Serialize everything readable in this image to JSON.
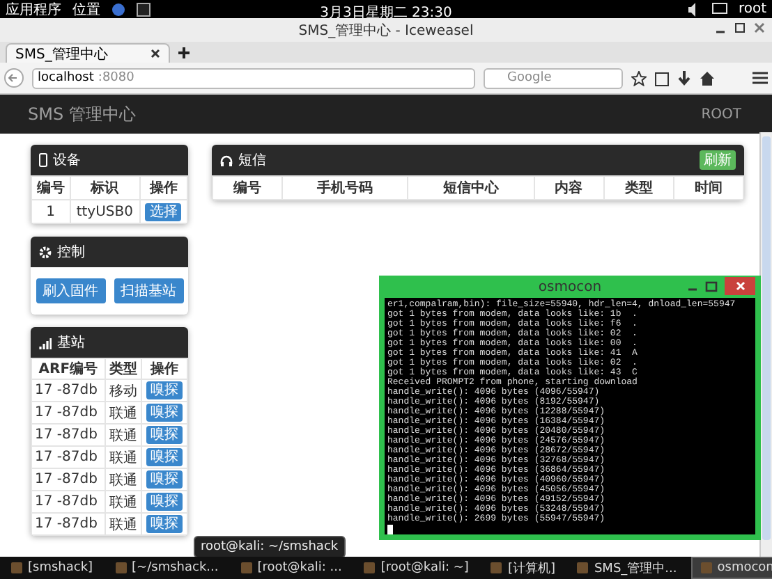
{
  "top_panel": {
    "menus": [
      "应用程序",
      "位置"
    ],
    "clock": "3月3日星期二 23:30",
    "user": "root"
  },
  "browser": {
    "title": "SMS_管理中心 - Iceweasel",
    "tab": "SMS_管理中心",
    "url_host": "localhost",
    "url_port": ":8080",
    "search": {
      "placeholder": "Google"
    }
  },
  "navbar": {
    "brand": "SMS 管理中心",
    "user": "ROOT"
  },
  "devices": {
    "title": "设备",
    "columns": [
      "编号",
      "标识",
      "操作"
    ],
    "rows": [
      {
        "id": "1",
        "name": "ttyUSB0",
        "action": "选择"
      }
    ]
  },
  "control": {
    "title": "控制",
    "buttons": [
      "刷入固件",
      "扫描基站"
    ]
  },
  "base_stations": {
    "title": "基站",
    "columns": [
      "ARF编号",
      "类型",
      "操作"
    ],
    "rows": [
      {
        "arfcn": "17",
        "signal": "-87db",
        "type": "移动",
        "action": "嗅探"
      },
      {
        "arfcn": "17",
        "signal": "-87db",
        "type": "联通",
        "action": "嗅探"
      },
      {
        "arfcn": "17",
        "signal": "-87db",
        "type": "联通",
        "action": "嗅探"
      },
      {
        "arfcn": "17",
        "signal": "-87db",
        "type": "联通",
        "action": "嗅探"
      },
      {
        "arfcn": "17",
        "signal": "-87db",
        "type": "联通",
        "action": "嗅探"
      },
      {
        "arfcn": "17",
        "signal": "-87db",
        "type": "联通",
        "action": "嗅探"
      },
      {
        "arfcn": "17",
        "signal": "-87db",
        "type": "联通",
        "action": "嗅探"
      }
    ]
  },
  "sms": {
    "title": "短信",
    "refresh": "刷新",
    "columns": [
      "编号",
      "手机号码",
      "短信中心",
      "内容",
      "类型",
      "时间"
    ]
  },
  "terminal": {
    "title": "osmocon",
    "lines": [
      "er1,compalram,bin): file_size=55940, hdr_len=4, dnload_len=55947",
      "got 1 bytes from modem, data looks like: 1b  .",
      "got 1 bytes from modem, data looks like: f6  .",
      "got 1 bytes from modem, data looks like: 02  .",
      "got 1 bytes from modem, data looks like: 00  .",
      "got 1 bytes from modem, data looks like: 41  A",
      "got 1 bytes from modem, data looks like: 02  .",
      "got 1 bytes from modem, data looks like: 43  C",
      "Received PROMPT2 from phone, starting download",
      "handle_write(): 4096 bytes (4096/55947)",
      "handle_write(): 4096 bytes (8192/55947)",
      "handle_write(): 4096 bytes (12288/55947)",
      "handle_write(): 4096 bytes (16384/55947)",
      "handle_write(): 4096 bytes (20480/55947)",
      "handle_write(): 4096 bytes (24576/55947)",
      "handle_write(): 4096 bytes (28672/55947)",
      "handle_write(): 4096 bytes (32768/55947)",
      "handle_write(): 4096 bytes (36864/55947)",
      "handle_write(): 4096 bytes (40960/55947)",
      "handle_write(): 4096 bytes (45056/55947)",
      "handle_write(): 4096 bytes (49152/55947)",
      "handle_write(): 4096 bytes (53248/55947)",
      "handle_write(): 2699 bytes (55947/55947)"
    ]
  },
  "tooltip": "root@kali: ~/smshack",
  "taskbar": [
    {
      "label": "[smshack]",
      "selected": false
    },
    {
      "label": "[~/smshack...",
      "selected": false
    },
    {
      "label": "[root@kali: ...",
      "selected": false
    },
    {
      "label": "[root@kali: ~]",
      "selected": false
    },
    {
      "label": "[计算机]",
      "selected": false
    },
    {
      "label": "SMS_管理中...",
      "selected": false
    },
    {
      "label": "osmocon",
      "selected": true
    }
  ]
}
